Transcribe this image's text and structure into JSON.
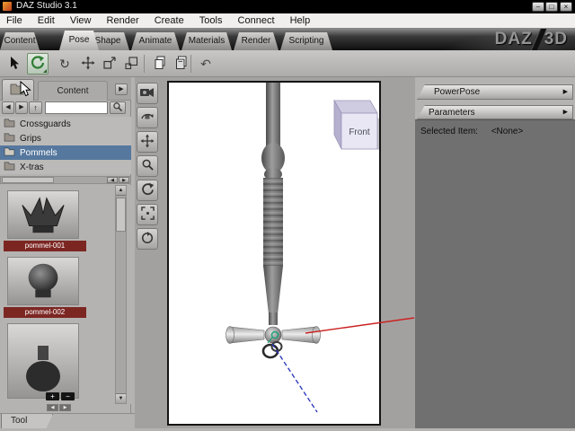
{
  "window": {
    "title": "DAZ Studio 3.1"
  },
  "menu": {
    "items": [
      "File",
      "Edit",
      "View",
      "Render",
      "Create",
      "Tools",
      "Connect",
      "Help"
    ]
  },
  "main_tabs": {
    "items": [
      "Content",
      "Pose",
      "Shape",
      "Animate",
      "Materials",
      "Render",
      "Scripting"
    ],
    "active": "Pose",
    "logo_daz": "DAZ",
    "logo_3d": "3D"
  },
  "left_panel": {
    "content_tab_label": "Content",
    "search_value": "",
    "folders": [
      {
        "label": "Crossguards",
        "selected": false
      },
      {
        "label": "Grips",
        "selected": false
      },
      {
        "label": "Pommels",
        "selected": true
      },
      {
        "label": "X-tras",
        "selected": false
      }
    ],
    "thumbnails": [
      {
        "label": "pommel-001"
      },
      {
        "label": "pommel-002"
      }
    ],
    "tool_tab_label": "Tool"
  },
  "viewport": {
    "view_cube_label": "Front"
  },
  "right_panel": {
    "powerpose_label": "PowerPose",
    "parameters_label": "Parameters",
    "selected_item_label": "Selected Item:",
    "selected_item_value": "<None>"
  },
  "icons": {
    "minimize": "–",
    "maximize": "□",
    "close": "×",
    "nav_back": "◀",
    "nav_forward": "▶",
    "nav_up": "↑",
    "pane_menu_arrow": "▶",
    "scroll_up": "▲",
    "scroll_down": "▼",
    "scroll_left": "◀",
    "scroll_right": "▶",
    "undo": "↶",
    "rotate": "↻",
    "zoom_in": "+",
    "zoom_out": "−"
  },
  "colors": {
    "selection_blue": "#56789e",
    "thumb_label_red": "#7c2622",
    "axis_red": "#cc2222",
    "axis_blue": "#2233bb"
  }
}
